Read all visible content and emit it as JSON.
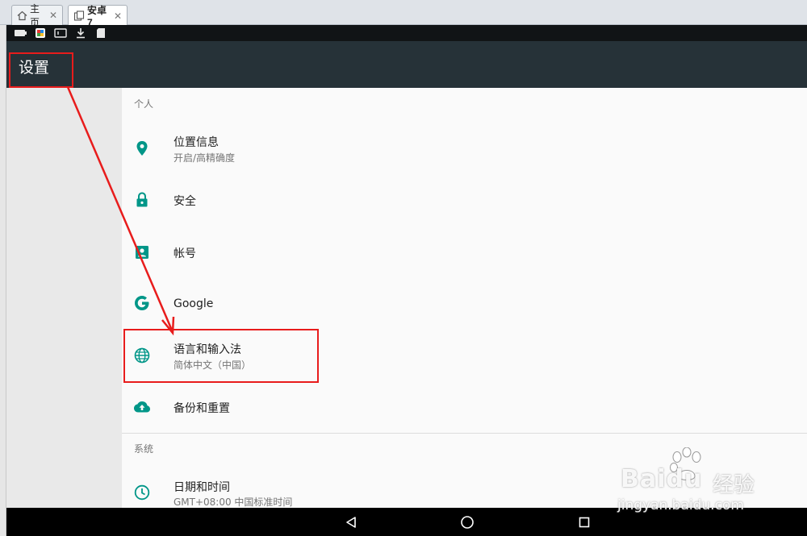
{
  "browser": {
    "tabs": [
      {
        "label": "主页",
        "close": "✕",
        "icon": "home-icon",
        "active": false
      },
      {
        "label": "安卓7",
        "close": "✕",
        "icon": "android-tab-icon",
        "active": true
      }
    ]
  },
  "emulator_toolbar": {
    "icons": [
      "battery-icon",
      "app-store-icon",
      "screen-icon",
      "download-icon",
      "sd-card-icon"
    ]
  },
  "appbar": {
    "title": "设置"
  },
  "sections": [
    {
      "header": "个人"
    },
    {
      "header": "系统"
    }
  ],
  "rows": [
    {
      "title": "位置信息",
      "subtitle": "开启/高精确度",
      "icon": "location-icon"
    },
    {
      "title": "安全",
      "subtitle": "",
      "icon": "lock-icon"
    },
    {
      "title": "帐号",
      "subtitle": "",
      "icon": "account-icon"
    },
    {
      "title": "Google",
      "subtitle": "",
      "icon": "google-icon"
    },
    {
      "title": "语言和输入法",
      "subtitle": "简体中文（中国）",
      "icon": "globe-icon"
    },
    {
      "title": "备份和重置",
      "subtitle": "",
      "icon": "cloud-upload-icon"
    },
    {
      "title": "日期和时间",
      "subtitle": "GMT+08:00 中国标准时间",
      "icon": "clock-icon"
    }
  ],
  "navbar": {
    "icons": [
      "back-icon",
      "home-icon",
      "recents-icon"
    ]
  },
  "watermark": {
    "main": "Bai",
    "main2": "du",
    "cn": "经验",
    "url": "jingyan.baidu.com"
  },
  "colors": {
    "accent": "#009688",
    "appbar": "#263238",
    "highlight": "#e81c1c"
  }
}
